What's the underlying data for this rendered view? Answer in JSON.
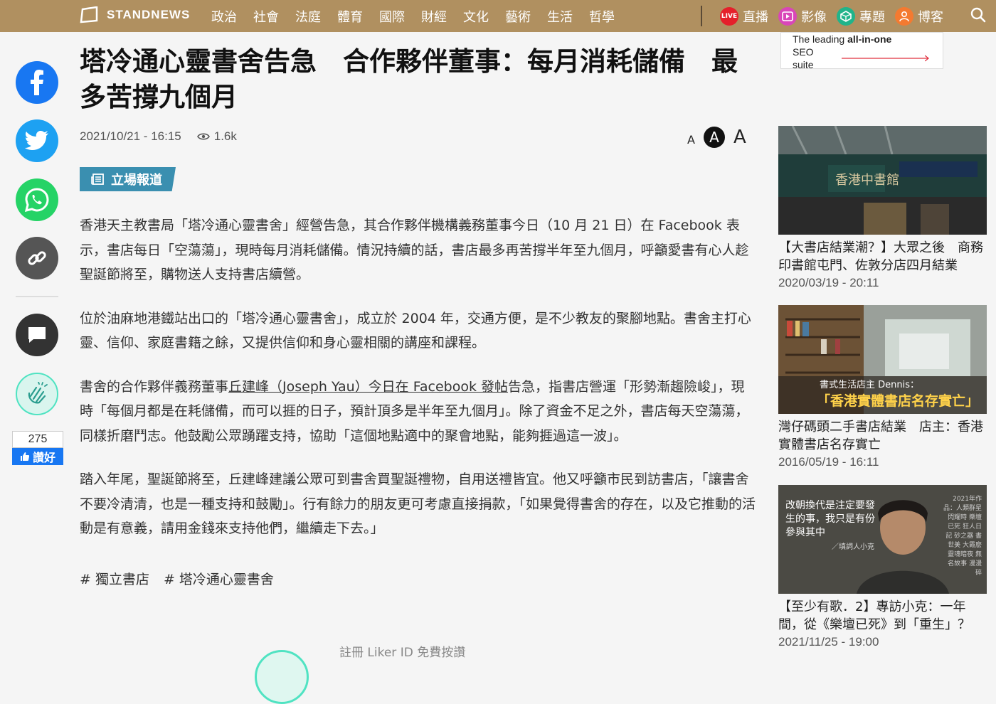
{
  "nav": {
    "logo": "STANDNEWS",
    "items": [
      "政治",
      "社會",
      "法庭",
      "體育",
      "國際",
      "財經",
      "文化",
      "藝術",
      "生活",
      "哲學"
    ],
    "live_badge": "LIVE",
    "right_items": [
      {
        "label": "直播",
        "icon": "live-icon",
        "color": "#e5202b"
      },
      {
        "label": "影像",
        "icon": "video-icon",
        "color": "#d946b8"
      },
      {
        "label": "專題",
        "icon": "topic-icon",
        "color": "#21b48a"
      },
      {
        "label": "博客",
        "icon": "blogger-icon",
        "color": "#f47a30"
      }
    ]
  },
  "article": {
    "title": "塔冷通心靈書舍告急　合作夥伴董事：每月消耗儲備　最多苦撐九個月",
    "date": "2021/10/21 - 16:15",
    "views": "1.6k",
    "font_small": "A",
    "font_medium": "A",
    "font_large": "A",
    "badge": "立場報道",
    "p1": "香港天主教書局「塔冷通心靈書舍」經營告急，其合作夥伴機構義務董事今日（10 月 21 日）在 Facebook 表示，書店每日「空蕩蕩」，現時每月消耗儲備。情況持續的話，書店最多再苦撐半年至九個月，呼籲愛書有心人趁聖誕節將至，購物送人支持書店續營。",
    "p2": "位於油麻地港鐵站出口的「塔冷通心靈書舍」，成立於 2004 年，交通方便，是不少教友的聚腳地點。書舍主打心靈、信仰、家庭書籍之餘，又提供信仰和身心靈相關的講座和課程。",
    "p3_pre": "書舍的合作夥伴義務董事",
    "p3_link1": "丘建峰（Joseph Yau）今日在 Facebook 發帖",
    "p3_post": "告急，指書店營運「形勢漸趨險峻」，現時「每個月都是在耗儲備，而可以捱的日子，預計頂多是半年至九個月」。除了資金不足之外，書店每天空蕩蕩，同樣折磨鬥志。他鼓勵公眾踴躍支持，協助「這個地點適中的聚會地點，能夠捱過這一波」。",
    "p4": "踏入年尾，聖誕節將至，丘建峰建議公眾可到書舍買聖誕禮物，自用送禮皆宜。他又呼籲市民到訪書店，「讓書舍不要冷清清，也是一種支持和鼓勵」。行有餘力的朋友更可考慮直接捐款，「如果覺得書舍的存在，以及它推動的活動是有意義，請用金錢來支持他們，繼續走下去。」",
    "tags": [
      "# 獨立書店",
      "# 塔冷通心靈書舍"
    ],
    "liker": "註冊 Liker ID 免費按讚"
  },
  "share": {
    "like_count": "275",
    "like_label": "讚好"
  },
  "ad": {
    "line1_pre": "The leading ",
    "line1_bold": "all-in-one",
    "line2": "SEO suite"
  },
  "related": [
    {
      "title": "【大書店結業潮？】大眾之後　商務印書館屯門、佐敦分店四月結業",
      "date": "2020/03/19 - 20:11"
    },
    {
      "title": "灣仔碼頭二手書店結業　店主：香港實體書店名存實亡",
      "date": "2016/05/19 - 16:11",
      "img_caption": "書式生活店主 Dennis：",
      "img_quote": "「香港實體書店名存實亡」"
    },
    {
      "title": "【至少有歌．2】專訪小克：一年間，從《樂壇已死》到「重生」？",
      "date": "2021/11/25 - 19:00",
      "img_quote": "改朝換代是注定要發生的事，我只是有份參與其中",
      "img_by": "／填詞人小克",
      "img_side": "2021年作品：人類群星閃耀時 樂壇已死 狂人日記 砂之器 書世美 大霞麼 靈魂暗夜 無名故事 漫漫碎"
    }
  ]
}
